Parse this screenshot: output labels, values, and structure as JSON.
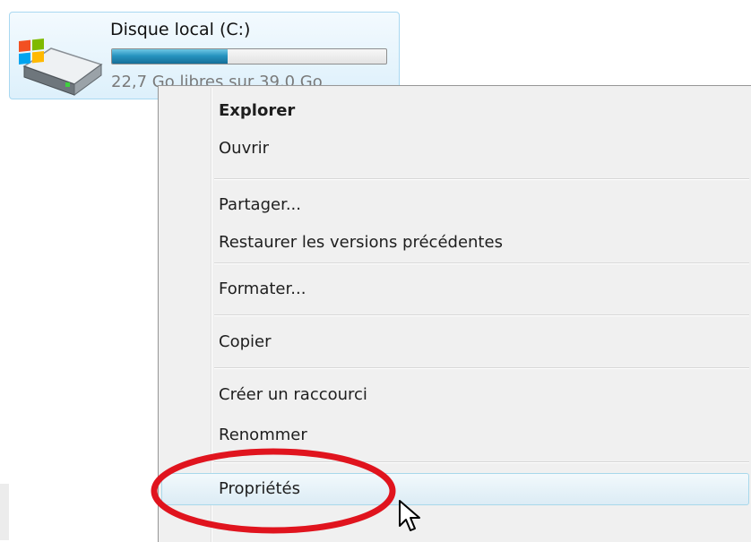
{
  "drive": {
    "name": "Disque local (C:)",
    "free_space": "22,7 Go libres sur 39,0 Go",
    "usage_fraction": 0.42,
    "icon": "hard-drive-windows-icon"
  },
  "context_menu": {
    "items": [
      {
        "label": "Explorer"
      },
      {
        "label": "Ouvrir"
      },
      {
        "label": "Partager..."
      },
      {
        "label": "Restaurer les versions précédentes"
      },
      {
        "label": "Formater..."
      },
      {
        "label": "Copier"
      },
      {
        "label": "Créer un raccourci"
      },
      {
        "label": "Renommer"
      },
      {
        "label": "Propriétés"
      }
    ]
  },
  "annotation": {
    "color": "#e0141e"
  },
  "colors": {
    "hover_border": "#a8d8eb",
    "usage_bar": "#2794c0"
  }
}
